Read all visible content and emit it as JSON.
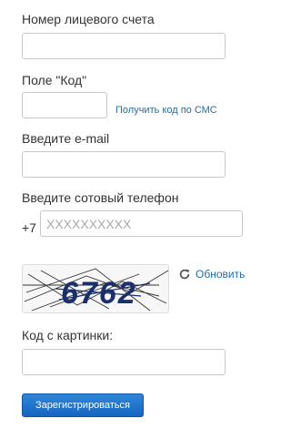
{
  "form": {
    "account_label": "Номер лицевого счета",
    "account_value": "",
    "code_label": "Поле \"Код\"",
    "code_value": "",
    "get_sms_code_link": "Получить код по СМС",
    "email_label": "Введите e-mail",
    "email_value": "",
    "phone_label": "Введите сотовый телефон",
    "phone_prefix": "+7",
    "phone_placeholder": "XXXXXXXXXX",
    "phone_value": "",
    "captcha_text": "6762",
    "refresh_label": "Обновить",
    "captcha_input_label": "Код с картинки:",
    "captcha_input_value": "",
    "submit_label": "Зарегистрироваться"
  },
  "icons": {
    "refresh": "refresh-icon"
  },
  "colors": {
    "link": "#1f6fa8",
    "button_top": "#2f86d8",
    "button_bottom": "#1565c0",
    "captcha_text": "#1a2f6b"
  }
}
